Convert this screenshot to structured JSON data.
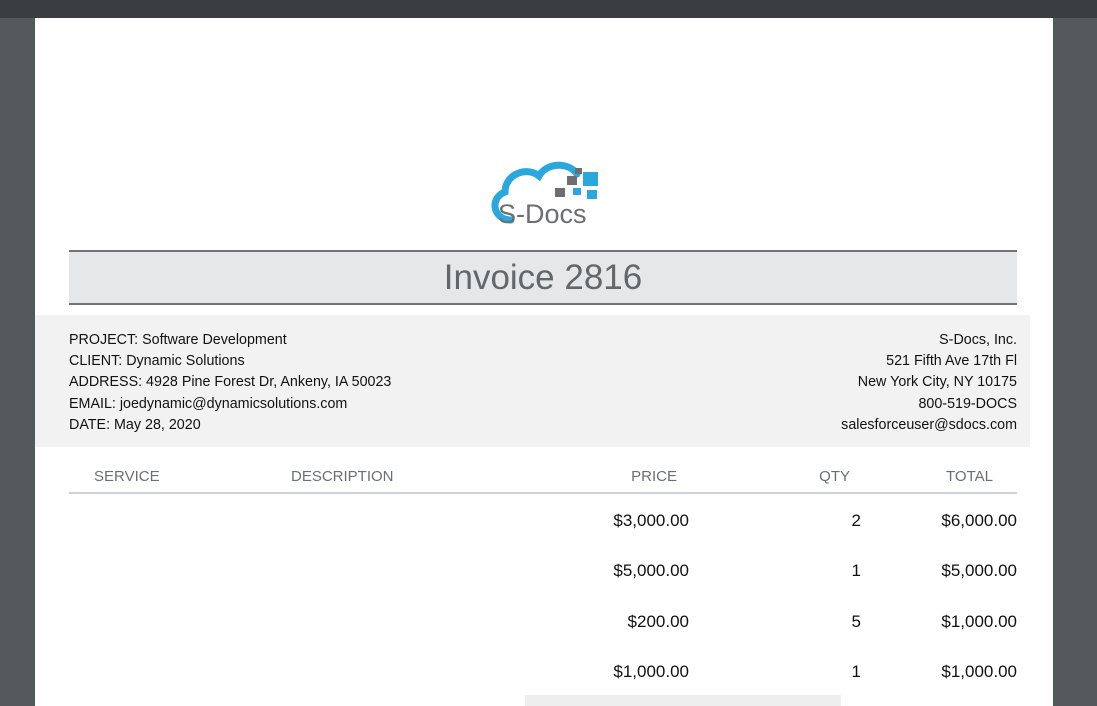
{
  "logo": {
    "text": "S-Docs",
    "alt": "S-Docs logo",
    "brand_blue": "#29a8e0",
    "brand_gray": "#6d6e71"
  },
  "title": "Invoice 2816",
  "client_info": [
    "PROJECT: Software Development",
    "CLIENT: Dynamic Solutions",
    "ADDRESS: 4928 Pine Forest Dr, Ankeny, IA 50023",
    "EMAIL: joedynamic@dynamicsolutions.com",
    "DATE: May 28, 2020"
  ],
  "company_info": [
    "S-Docs, Inc.",
    "521 Fifth Ave 17th Fl",
    "New York City, NY 10175",
    "800-519-DOCS",
    "salesforceuser@sdocs.com"
  ],
  "table": {
    "headers": {
      "service": "SERVICE",
      "description": "DESCRIPTION",
      "price": "PRICE",
      "qty": "QTY",
      "total": "TOTAL"
    },
    "rows": [
      {
        "service": "",
        "description": "",
        "price": "$3,000.00",
        "qty": "2",
        "total": "$6,000.00"
      },
      {
        "service": "",
        "description": "",
        "price": "$5,000.00",
        "qty": "1",
        "total": "$5,000.00"
      },
      {
        "service": "",
        "description": "",
        "price": "$200.00",
        "qty": "5",
        "total": "$1,000.00"
      },
      {
        "service": "",
        "description": "",
        "price": "$1,000.00",
        "qty": "1",
        "total": "$1,000.00"
      }
    ]
  },
  "colors": {
    "viewer_bg": "#53585b",
    "title_bg": "#e6e7e8",
    "info_bg": "#f2f2f2"
  }
}
